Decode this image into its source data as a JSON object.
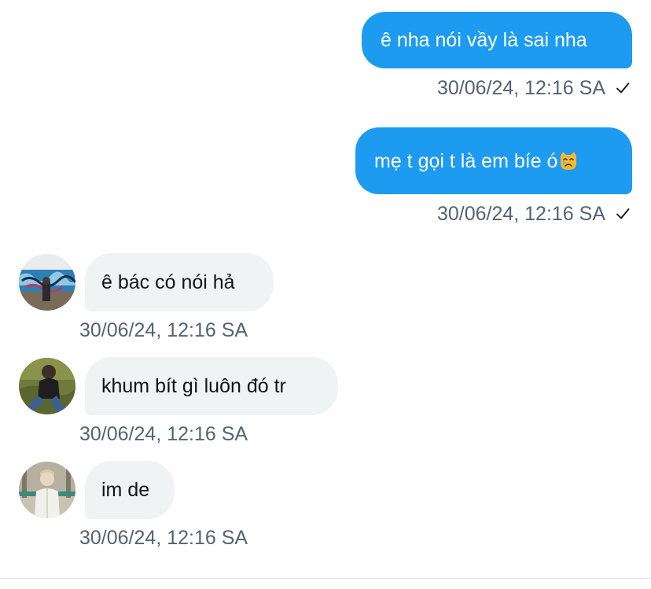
{
  "messages": [
    {
      "direction": "out",
      "text": "ê nha nói vầy là sai nha",
      "time": "30/06/24, 12:16 SA",
      "status": "sent-check"
    },
    {
      "direction": "out",
      "text": "mẹ t gọi t là em bíe ó",
      "emoji": "crying-cat-face-emoji",
      "time": "30/06/24, 12:16 SA",
      "status": "sent-check"
    },
    {
      "direction": "in",
      "text": "ê bác có nói hả",
      "time": "30/06/24, 12:16 SA",
      "avatar": "graffiti-wall-photo"
    },
    {
      "direction": "in",
      "text": "khum bít gì luôn đó tr",
      "time": "30/06/24, 12:16 SA",
      "avatar": "person-sitting-on-grass-photo"
    },
    {
      "direction": "in",
      "text": "im de",
      "time": "30/06/24, 12:16 SA",
      "avatar": "person-in-white-jacket-photo"
    }
  ],
  "colors": {
    "outgoing_bubble": "#1d9bf0",
    "incoming_bubble": "#eff3f4",
    "timestamp": "#536471",
    "incoming_text": "#0f1419"
  }
}
